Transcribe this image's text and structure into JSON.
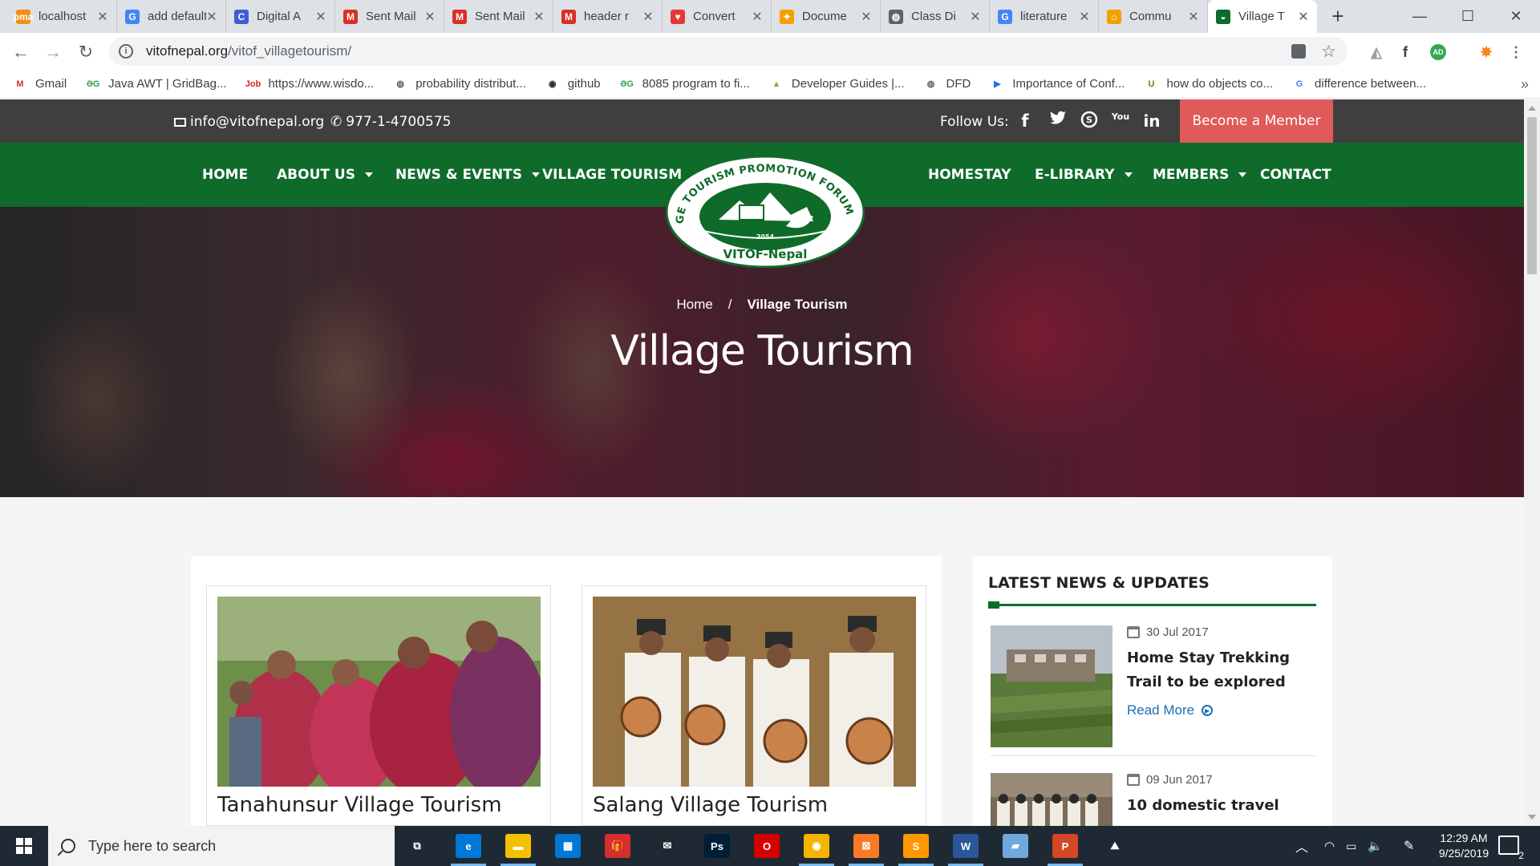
{
  "browser": {
    "tabs": [
      {
        "title": "localhost",
        "color": "#f29111",
        "glyph": "pma"
      },
      {
        "title": "add default",
        "color": "#4285f4",
        "glyph": "G"
      },
      {
        "title": "Digital A",
        "color": "#3b5fd9",
        "glyph": "C"
      },
      {
        "title": "Sent Mail",
        "color": "#d93025",
        "glyph": "M"
      },
      {
        "title": "Sent Mail",
        "color": "#d93025",
        "glyph": "M"
      },
      {
        "title": "header r",
        "color": "#d93025",
        "glyph": "M"
      },
      {
        "title": "Convert",
        "color": "#e53935",
        "glyph": "♥"
      },
      {
        "title": "Docume",
        "color": "#f4a100",
        "glyph": "✦"
      },
      {
        "title": "Class Di",
        "color": "#5f6368",
        "glyph": "◍"
      },
      {
        "title": "literature",
        "color": "#4285f4",
        "glyph": "G"
      },
      {
        "title": "Commu",
        "color": "#f4a100",
        "glyph": "⌂"
      },
      {
        "title": "Village T",
        "color": "#0f6b2a",
        "glyph": "◒",
        "active": true
      }
    ],
    "new_tab": "+",
    "window_controls": {
      "minimize": "—",
      "maximize": "☐",
      "close": "✕"
    },
    "url_host": "vitofnepal.org",
    "url_path": "/vitof_villagetourism/",
    "nav": {
      "back": "←",
      "forward": "→",
      "reload": "↻"
    },
    "star": "☆",
    "bookmarks": [
      {
        "label": "Gmail",
        "color": "#d93025",
        "glyph": "M"
      },
      {
        "label": "Java AWT | GridBag...",
        "color": "#2e9e4f",
        "glyph": "ƏG"
      },
      {
        "label": "https://www.wisdo...",
        "color": "#e01f26",
        "glyph": "Job"
      },
      {
        "label": "probability distribut...",
        "color": "#5f6368",
        "glyph": "◍"
      },
      {
        "label": "github",
        "color": "#24292e",
        "glyph": "◉"
      },
      {
        "label": "8085 program to fi...",
        "color": "#2e9e4f",
        "glyph": "ƏG"
      },
      {
        "label": "Developer Guides |...",
        "color": "#7cb342",
        "glyph": "▲"
      },
      {
        "label": "DFD",
        "color": "#5f6368",
        "glyph": "◍"
      },
      {
        "label": "Importance of Conf...",
        "color": "#1a73e8",
        "glyph": "▶"
      },
      {
        "label": "how do objects co...",
        "color": "#8a6d1c",
        "glyph": "U"
      },
      {
        "label": "difference between...",
        "color": "#4285f4",
        "glyph": "G"
      }
    ],
    "bookmarks_more": "»",
    "extensions": [
      {
        "glyph": "◭",
        "color": "#9aa0a6"
      },
      {
        "glyph": "f",
        "color": "#3c4043"
      },
      {
        "glyph": "AD",
        "color": "#34a853"
      },
      {
        "glyph": "✸",
        "color": "#f6851b"
      },
      {
        "glyph": "⋮",
        "color": "#5f6368"
      }
    ]
  },
  "site": {
    "email": "info@vitofnepal.org",
    "phone": "977-1-4700575",
    "follow_label": "Follow Us:",
    "social": [
      "f",
      "t",
      "S",
      "You",
      "in"
    ],
    "member_button": "Become a Member",
    "nav_left": [
      {
        "label": "HOME",
        "dropdown": false
      },
      {
        "label": "ABOUT US",
        "dropdown": true
      },
      {
        "label": "NEWS & EVENTS",
        "dropdown": true
      },
      {
        "label": "VILLAGE TOURISM",
        "dropdown": false
      }
    ],
    "nav_right": [
      {
        "label": "HOMESTAY",
        "dropdown": false
      },
      {
        "label": "E-LIBRARY",
        "dropdown": true
      },
      {
        "label": "MEMBERS",
        "dropdown": true
      },
      {
        "label": "CONTACT",
        "dropdown": false
      }
    ],
    "logo": {
      "arc_text": "VILLAGE TOURISM PROMOTION FORUM NEPAL",
      "year": "2054",
      "name": "VITOF-Nepal"
    },
    "breadcrumb": {
      "home": "Home",
      "sep": "/",
      "current": "Village Tourism"
    },
    "hero_title": "Village Tourism",
    "tours": [
      {
        "title": "Tanahunsur Village Tourism"
      },
      {
        "title": "Salang Village Tourism"
      }
    ],
    "sidebar": {
      "heading": "LATEST NEWS & UPDATES",
      "news": [
        {
          "date": "30 Jul 2017",
          "title": "Home Stay Trekking Trail to be explored",
          "read_more": "Read More"
        },
        {
          "date": "09 Jun 2017",
          "title": "10 domestic travel",
          "read_more": ""
        }
      ]
    }
  },
  "taskbar": {
    "search_placeholder": "Type here to search",
    "apps": [
      {
        "glyph": "⧉",
        "color": "transparent"
      },
      {
        "glyph": "e",
        "color": "#0078d7"
      },
      {
        "glyph": "▬",
        "color": "#f2c200"
      },
      {
        "glyph": "▦",
        "color": "#0078d7"
      },
      {
        "glyph": "🎁",
        "color": "#d32f2f"
      },
      {
        "glyph": "✉",
        "color": "transparent"
      },
      {
        "glyph": "Ps",
        "color": "#001e36"
      },
      {
        "glyph": "O",
        "color": "#d50000"
      },
      {
        "glyph": "◉",
        "color": "#f4b400"
      },
      {
        "glyph": "⊠",
        "color": "#fb7a24"
      },
      {
        "glyph": "S",
        "color": "#ff9800"
      },
      {
        "glyph": "W",
        "color": "#2b579a"
      },
      {
        "glyph": "▰",
        "color": "#6fa8dc"
      },
      {
        "glyph": "P",
        "color": "#d24726"
      },
      {
        "glyph": "⛰",
        "color": "transparent"
      }
    ],
    "time": "12:29 AM",
    "date": "9/25/2019",
    "notifications": "2"
  }
}
